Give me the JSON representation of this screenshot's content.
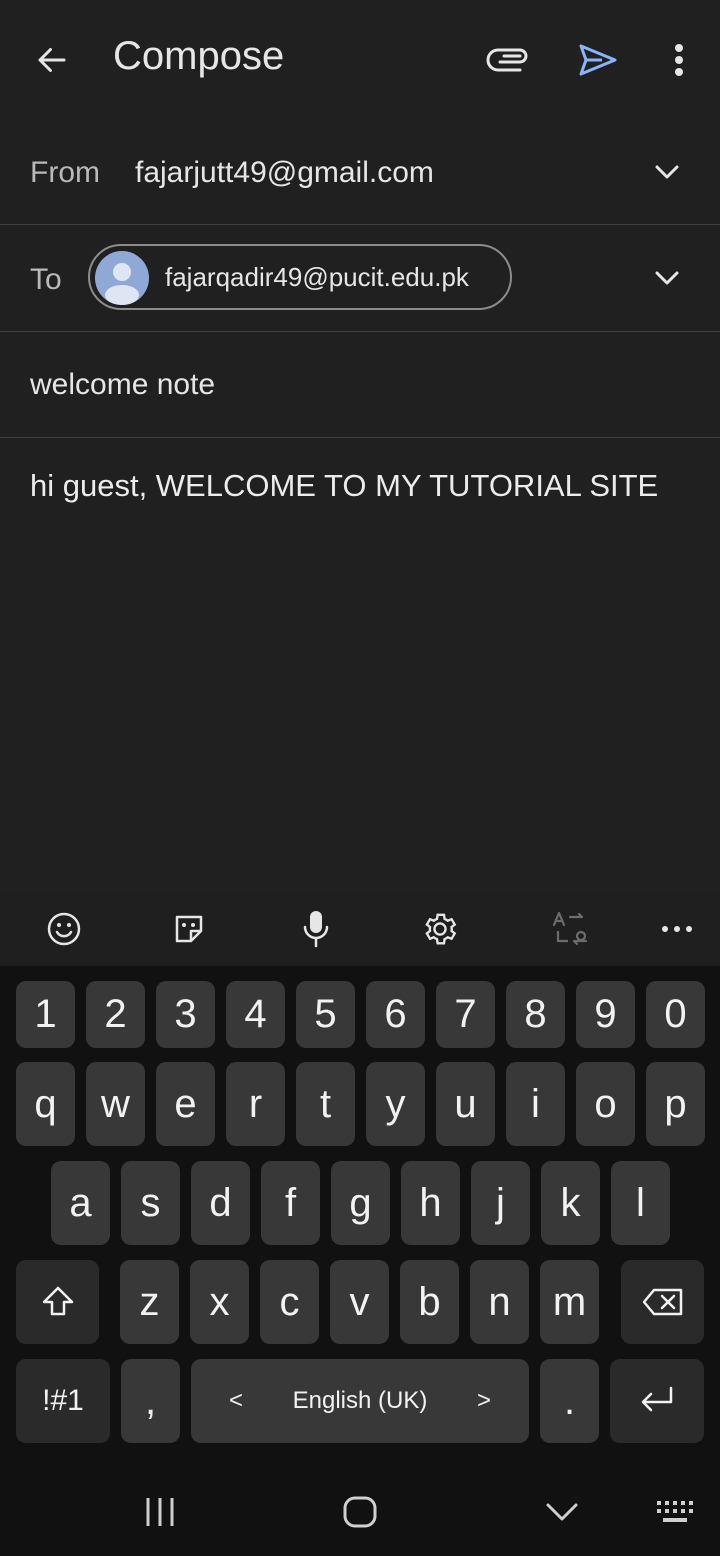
{
  "appbar": {
    "title": "Compose",
    "icons": [
      "back-arrow-icon",
      "attach-icon",
      "send-icon",
      "more-vert-icon"
    ]
  },
  "from": {
    "label": "From",
    "value": "fajarjutt49@gmail.com"
  },
  "to": {
    "label": "To",
    "recipient": "fajarqadir49@pucit.edu.pk"
  },
  "subject": "welcome note",
  "body": "hi guest, WELCOME TO MY TUTORIAL SITE",
  "keyboard": {
    "toolbar_icons": [
      "emoji-icon",
      "sticker-icon",
      "mic-icon",
      "settings-icon",
      "translate-icon",
      "more-horiz-icon"
    ],
    "row_numbers": [
      "1",
      "2",
      "3",
      "4",
      "5",
      "6",
      "7",
      "8",
      "9",
      "0"
    ],
    "row_q": [
      "q",
      "w",
      "e",
      "r",
      "t",
      "y",
      "u",
      "i",
      "o",
      "p"
    ],
    "row_a": [
      "a",
      "s",
      "d",
      "f",
      "g",
      "h",
      "j",
      "k",
      "l"
    ],
    "row_z": [
      "z",
      "x",
      "c",
      "v",
      "b",
      "n",
      "m"
    ],
    "sym_label": "!#1",
    "comma": ",",
    "space_label": "English (UK)",
    "space_left": "<",
    "space_right": ">",
    "period": "."
  },
  "colors": {
    "background": "#202020",
    "send": "#8ab4f8",
    "avatar": "#8fa8d6"
  }
}
